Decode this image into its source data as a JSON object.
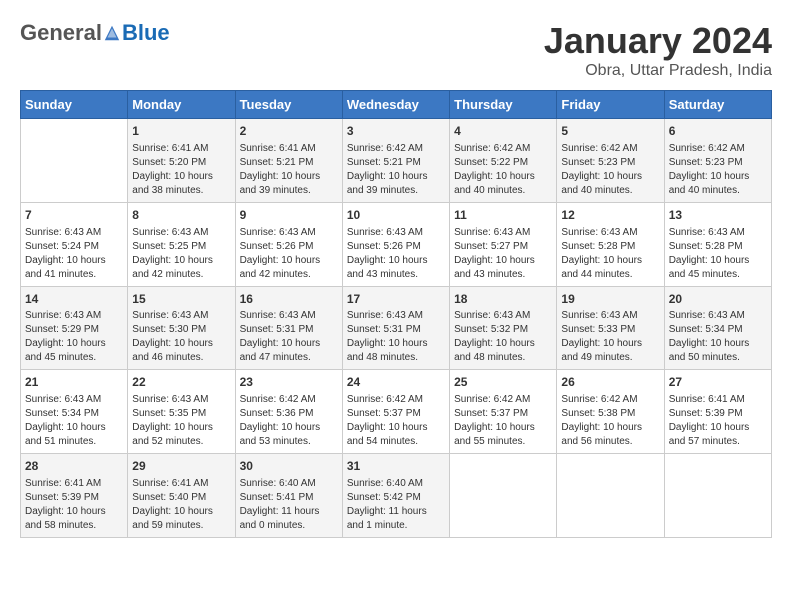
{
  "header": {
    "logo_general": "General",
    "logo_blue": "Blue",
    "month_title": "January 2024",
    "subtitle": "Obra, Uttar Pradesh, India"
  },
  "days_of_week": [
    "Sunday",
    "Monday",
    "Tuesday",
    "Wednesday",
    "Thursday",
    "Friday",
    "Saturday"
  ],
  "weeks": [
    [
      {
        "day": "",
        "info": ""
      },
      {
        "day": "1",
        "info": "Sunrise: 6:41 AM\nSunset: 5:20 PM\nDaylight: 10 hours\nand 38 minutes."
      },
      {
        "day": "2",
        "info": "Sunrise: 6:41 AM\nSunset: 5:21 PM\nDaylight: 10 hours\nand 39 minutes."
      },
      {
        "day": "3",
        "info": "Sunrise: 6:42 AM\nSunset: 5:21 PM\nDaylight: 10 hours\nand 39 minutes."
      },
      {
        "day": "4",
        "info": "Sunrise: 6:42 AM\nSunset: 5:22 PM\nDaylight: 10 hours\nand 40 minutes."
      },
      {
        "day": "5",
        "info": "Sunrise: 6:42 AM\nSunset: 5:23 PM\nDaylight: 10 hours\nand 40 minutes."
      },
      {
        "day": "6",
        "info": "Sunrise: 6:42 AM\nSunset: 5:23 PM\nDaylight: 10 hours\nand 40 minutes."
      }
    ],
    [
      {
        "day": "7",
        "info": "Sunrise: 6:43 AM\nSunset: 5:24 PM\nDaylight: 10 hours\nand 41 minutes."
      },
      {
        "day": "8",
        "info": "Sunrise: 6:43 AM\nSunset: 5:25 PM\nDaylight: 10 hours\nand 42 minutes."
      },
      {
        "day": "9",
        "info": "Sunrise: 6:43 AM\nSunset: 5:26 PM\nDaylight: 10 hours\nand 42 minutes."
      },
      {
        "day": "10",
        "info": "Sunrise: 6:43 AM\nSunset: 5:26 PM\nDaylight: 10 hours\nand 43 minutes."
      },
      {
        "day": "11",
        "info": "Sunrise: 6:43 AM\nSunset: 5:27 PM\nDaylight: 10 hours\nand 43 minutes."
      },
      {
        "day": "12",
        "info": "Sunrise: 6:43 AM\nSunset: 5:28 PM\nDaylight: 10 hours\nand 44 minutes."
      },
      {
        "day": "13",
        "info": "Sunrise: 6:43 AM\nSunset: 5:28 PM\nDaylight: 10 hours\nand 45 minutes."
      }
    ],
    [
      {
        "day": "14",
        "info": "Sunrise: 6:43 AM\nSunset: 5:29 PM\nDaylight: 10 hours\nand 45 minutes."
      },
      {
        "day": "15",
        "info": "Sunrise: 6:43 AM\nSunset: 5:30 PM\nDaylight: 10 hours\nand 46 minutes."
      },
      {
        "day": "16",
        "info": "Sunrise: 6:43 AM\nSunset: 5:31 PM\nDaylight: 10 hours\nand 47 minutes."
      },
      {
        "day": "17",
        "info": "Sunrise: 6:43 AM\nSunset: 5:31 PM\nDaylight: 10 hours\nand 48 minutes."
      },
      {
        "day": "18",
        "info": "Sunrise: 6:43 AM\nSunset: 5:32 PM\nDaylight: 10 hours\nand 48 minutes."
      },
      {
        "day": "19",
        "info": "Sunrise: 6:43 AM\nSunset: 5:33 PM\nDaylight: 10 hours\nand 49 minutes."
      },
      {
        "day": "20",
        "info": "Sunrise: 6:43 AM\nSunset: 5:34 PM\nDaylight: 10 hours\nand 50 minutes."
      }
    ],
    [
      {
        "day": "21",
        "info": "Sunrise: 6:43 AM\nSunset: 5:34 PM\nDaylight: 10 hours\nand 51 minutes."
      },
      {
        "day": "22",
        "info": "Sunrise: 6:43 AM\nSunset: 5:35 PM\nDaylight: 10 hours\nand 52 minutes."
      },
      {
        "day": "23",
        "info": "Sunrise: 6:42 AM\nSunset: 5:36 PM\nDaylight: 10 hours\nand 53 minutes."
      },
      {
        "day": "24",
        "info": "Sunrise: 6:42 AM\nSunset: 5:37 PM\nDaylight: 10 hours\nand 54 minutes."
      },
      {
        "day": "25",
        "info": "Sunrise: 6:42 AM\nSunset: 5:37 PM\nDaylight: 10 hours\nand 55 minutes."
      },
      {
        "day": "26",
        "info": "Sunrise: 6:42 AM\nSunset: 5:38 PM\nDaylight: 10 hours\nand 56 minutes."
      },
      {
        "day": "27",
        "info": "Sunrise: 6:41 AM\nSunset: 5:39 PM\nDaylight: 10 hours\nand 57 minutes."
      }
    ],
    [
      {
        "day": "28",
        "info": "Sunrise: 6:41 AM\nSunset: 5:39 PM\nDaylight: 10 hours\nand 58 minutes."
      },
      {
        "day": "29",
        "info": "Sunrise: 6:41 AM\nSunset: 5:40 PM\nDaylight: 10 hours\nand 59 minutes."
      },
      {
        "day": "30",
        "info": "Sunrise: 6:40 AM\nSunset: 5:41 PM\nDaylight: 11 hours\nand 0 minutes."
      },
      {
        "day": "31",
        "info": "Sunrise: 6:40 AM\nSunset: 5:42 PM\nDaylight: 11 hours\nand 1 minute."
      },
      {
        "day": "",
        "info": ""
      },
      {
        "day": "",
        "info": ""
      },
      {
        "day": "",
        "info": ""
      }
    ]
  ]
}
